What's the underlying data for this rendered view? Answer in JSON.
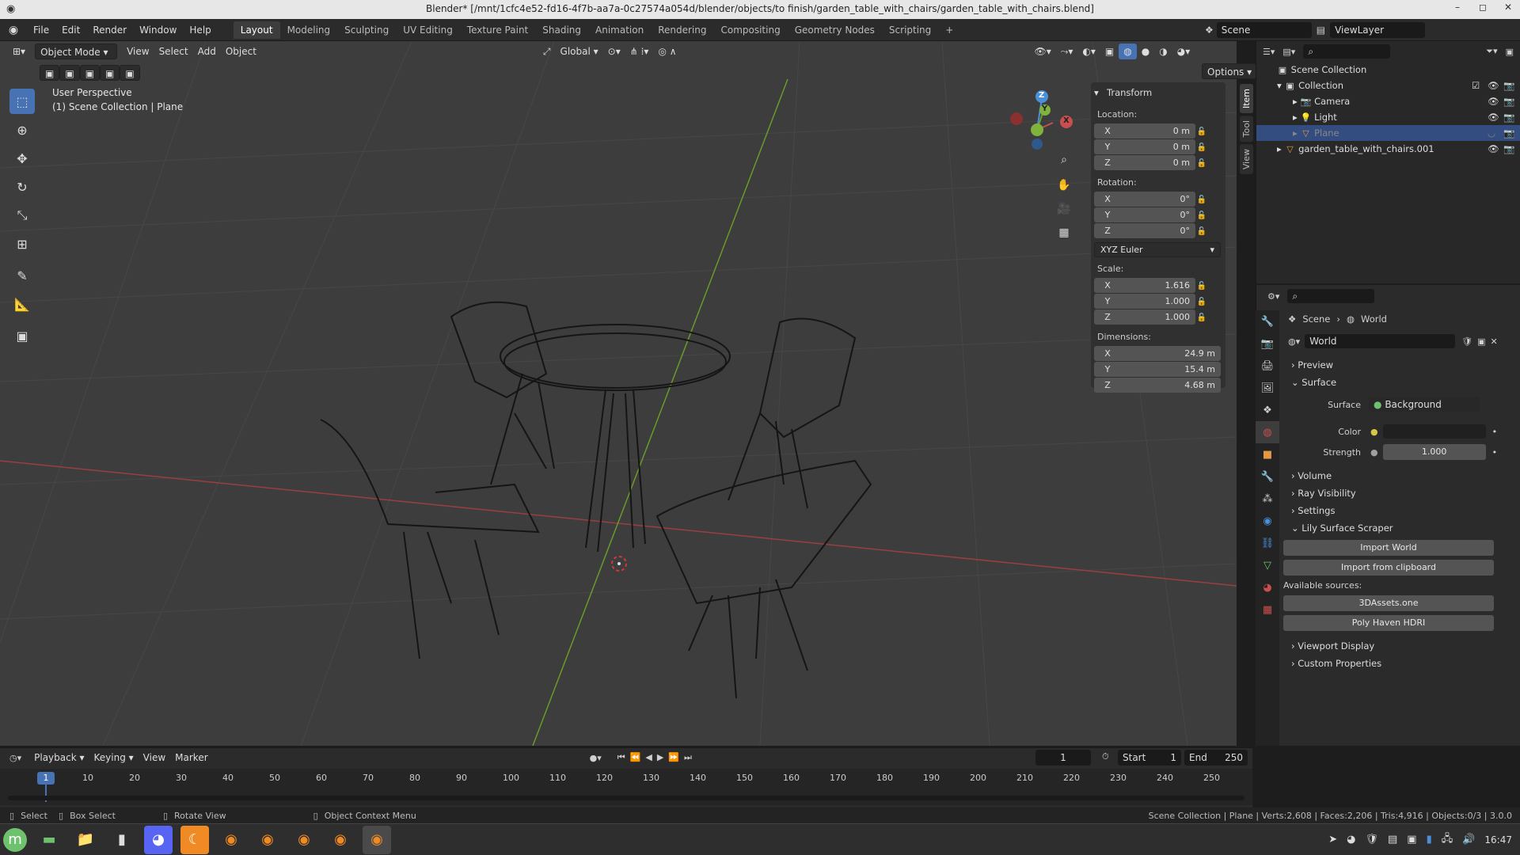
{
  "window": {
    "title": "Blender* [/mnt/1cfc4e52-fd16-4f7b-aa7a-0c27574a054d/blender/objects/to finish/garden_table_with_chairs/garden_table_with_chairs.blend]"
  },
  "menus": [
    "File",
    "Edit",
    "Render",
    "Window",
    "Help"
  ],
  "workspaces": [
    "Layout",
    "Modeling",
    "Sculpting",
    "UV Editing",
    "Texture Paint",
    "Shading",
    "Animation",
    "Rendering",
    "Compositing",
    "Geometry Nodes",
    "Scripting"
  ],
  "active_workspace": "Layout",
  "scene": {
    "scene_name": "Scene",
    "view_layer": "ViewLayer"
  },
  "viewport": {
    "mode": "Object Mode",
    "menus": [
      "View",
      "Select",
      "Add",
      "Object"
    ],
    "orientation": "Global",
    "options_label": "Options",
    "perspective_label": "User Perspective",
    "context_label": "(1) Scene Collection | Plane",
    "gizmo_axes": {
      "x": "X",
      "y": "Y",
      "z": "Z"
    }
  },
  "npanel": {
    "header": "Transform",
    "tabs": [
      "Item",
      "Tool",
      "View"
    ],
    "location_label": "Location:",
    "location": {
      "x": "0 m",
      "y": "0 m",
      "z": "0 m"
    },
    "rotation_label": "Rotation:",
    "rotation": {
      "x": "0°",
      "y": "0°",
      "z": "0°"
    },
    "rotation_mode": "XYZ Euler",
    "scale_label": "Scale:",
    "scale": {
      "x": "1.616",
      "y": "1.000",
      "z": "1.000"
    },
    "dimensions_label": "Dimensions:",
    "dimensions": {
      "x": "24.9 m",
      "y": "15.4 m",
      "z": "4.68 m"
    },
    "axis_labels": {
      "x": "X",
      "y": "Y",
      "z": "Z"
    }
  },
  "outliner": {
    "root": "Scene Collection",
    "items": [
      {
        "name": "Collection"
      },
      {
        "name": "Camera"
      },
      {
        "name": "Light"
      },
      {
        "name": "Plane"
      },
      {
        "name": "garden_table_with_chairs.001"
      }
    ]
  },
  "properties": {
    "breadcrumb": {
      "scene": "Scene",
      "world": "World"
    },
    "world_name": "World",
    "panels": {
      "preview": "Preview",
      "surface": "Surface",
      "volume": "Volume",
      "ray_visibility": "Ray Visibility",
      "settings": "Settings",
      "scraper": "Lily Surface Scraper",
      "viewport_display": "Viewport Display",
      "custom_properties": "Custom Properties"
    },
    "surface_label": "Surface",
    "surface_value": "Background",
    "color_label": "Color",
    "strength_label": "Strength",
    "strength_value": "1.000",
    "buttons": {
      "import_world": "Import World",
      "import_clipboard": "Import from clipboard",
      "available_sources": "Available sources:",
      "source1": "3DAssets.one",
      "source2": "Poly Haven HDRI"
    }
  },
  "timeline": {
    "menus": [
      "Playback",
      "Keying",
      "View",
      "Marker"
    ],
    "current_frame": "1",
    "start_label": "Start",
    "start": "1",
    "end_label": "End",
    "end": "250",
    "ticks": [
      "10",
      "20",
      "30",
      "40",
      "50",
      "60",
      "70",
      "80",
      "90",
      "100",
      "110",
      "120",
      "130",
      "140",
      "150",
      "160",
      "170",
      "180",
      "190",
      "200",
      "210",
      "220",
      "230",
      "240",
      "250"
    ]
  },
  "statusbar": {
    "select": "Select",
    "box_select": "Box Select",
    "rotate_view": "Rotate View",
    "context_menu": "Object Context Menu",
    "stats": "Scene Collection | Plane | Verts:2,608 | Faces:2,206 | Tris:4,916 | Objects:0/3 | 3.0.0"
  },
  "taskbar": {
    "clock": "16:47"
  },
  "colors": {
    "accent": "#4772b3",
    "x_axis": "#c94f4f",
    "y_axis": "#7fb33b",
    "z_axis": "#4a90d9",
    "selected_row": "#334d80"
  }
}
